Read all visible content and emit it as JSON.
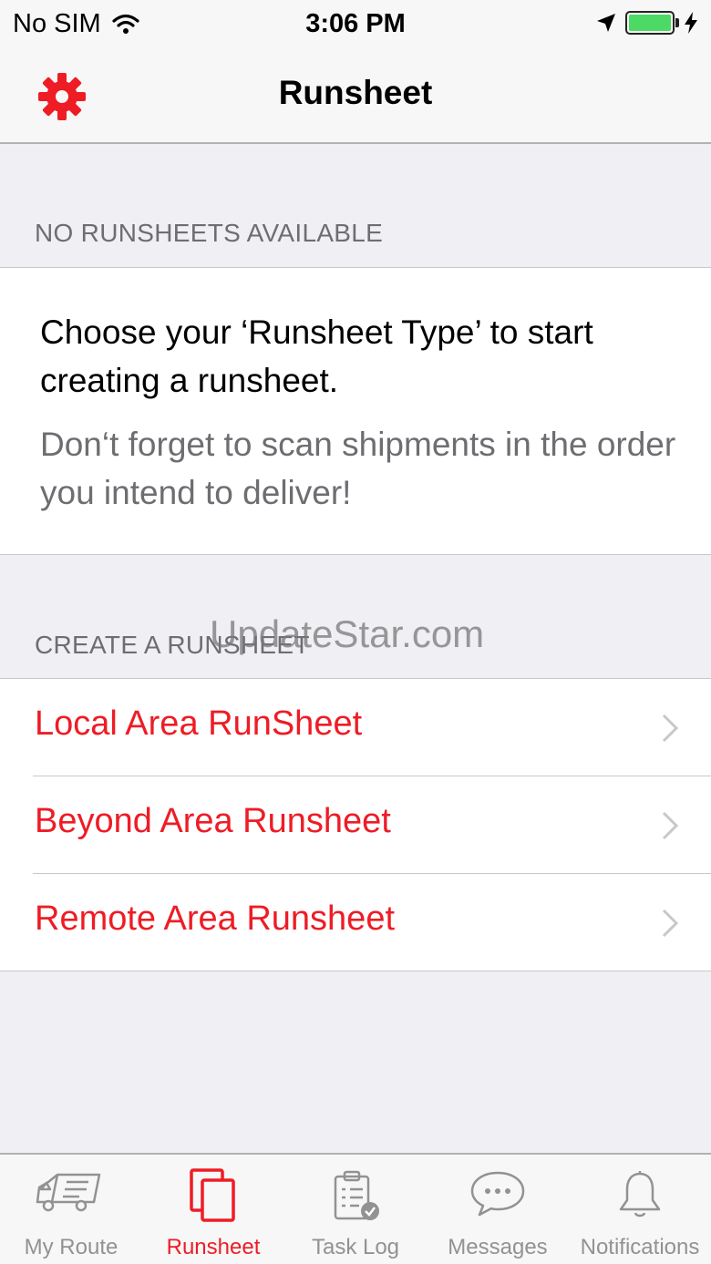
{
  "status_bar": {
    "carrier": "No SIM",
    "time": "3:06 PM",
    "battery_level": 1.0
  },
  "nav": {
    "title": "Runsheet",
    "settings_icon": "gear-icon"
  },
  "sections": {
    "empty_header": "NO RUNSHEETS AVAILABLE",
    "info_main": "Choose your ‘Runsheet Type’ to start creating a runsheet.",
    "info_sub": "Don‘t forget to scan shipments in the order you intend to deliver!",
    "create_header": "CREATE A RUNSHEET"
  },
  "runsheet_types": [
    {
      "label": "Local Area RunSheet"
    },
    {
      "label": "Beyond Area Runsheet"
    },
    {
      "label": "Remote Area Runsheet"
    }
  ],
  "watermark": "UpdateStar.com",
  "tabs": [
    {
      "label": "My Route",
      "icon": "truck-icon",
      "active": false
    },
    {
      "label": "Runsheet",
      "icon": "documents-icon",
      "active": true
    },
    {
      "label": "Task Log",
      "icon": "clipboard-check-icon",
      "active": false
    },
    {
      "label": "Messages",
      "icon": "chat-bubble-icon",
      "active": false
    },
    {
      "label": "Notifications",
      "icon": "bell-icon",
      "active": false
    }
  ],
  "colors": {
    "accent": "#ee1c25",
    "inactive": "#929292",
    "background": "#efeff4"
  }
}
